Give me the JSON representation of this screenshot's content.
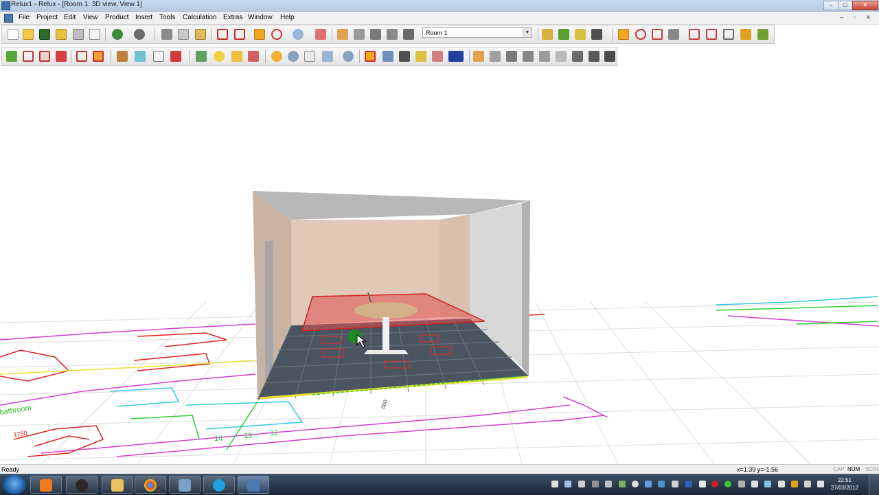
{
  "window": {
    "title": "Relux1 - Relux - [Room 1: 3D view, View 1]",
    "minimize": "–",
    "maximize": "□",
    "close": "✕"
  },
  "menu": [
    "File",
    "Project",
    "Edit",
    "View",
    "Product",
    "Insert",
    "Tools",
    "Calculation",
    "Extras",
    "Window",
    "Help"
  ],
  "toolbar": {
    "room_select": {
      "value": "Room 1",
      "arrow": "▼"
    }
  },
  "drawing_labels": [
    "bathroom",
    "14",
    "13",
    "12",
    "1750",
    "000"
  ],
  "status": {
    "text": "Ready",
    "coords": "x=1.39 y=-1.56",
    "indicators": [
      "CAP",
      "NUM",
      "SCRL"
    ]
  },
  "taskbar": {
    "apps": [
      "media-player",
      "hp",
      "file-explorer",
      "chrome",
      "network-tool",
      "skype",
      "relux"
    ],
    "clock_time": "22:51",
    "clock_date": "27/03/2012"
  },
  "colors": {
    "accent_orange": "#e8a020",
    "room_wall": "#d5bca8",
    "floor": "#4b5461",
    "workplane": "#e05050",
    "cad_magenta": "#d040d0",
    "cad_green": "#30d030",
    "cad_cyan": "#30c8e0",
    "cad_red": "#e02020"
  }
}
